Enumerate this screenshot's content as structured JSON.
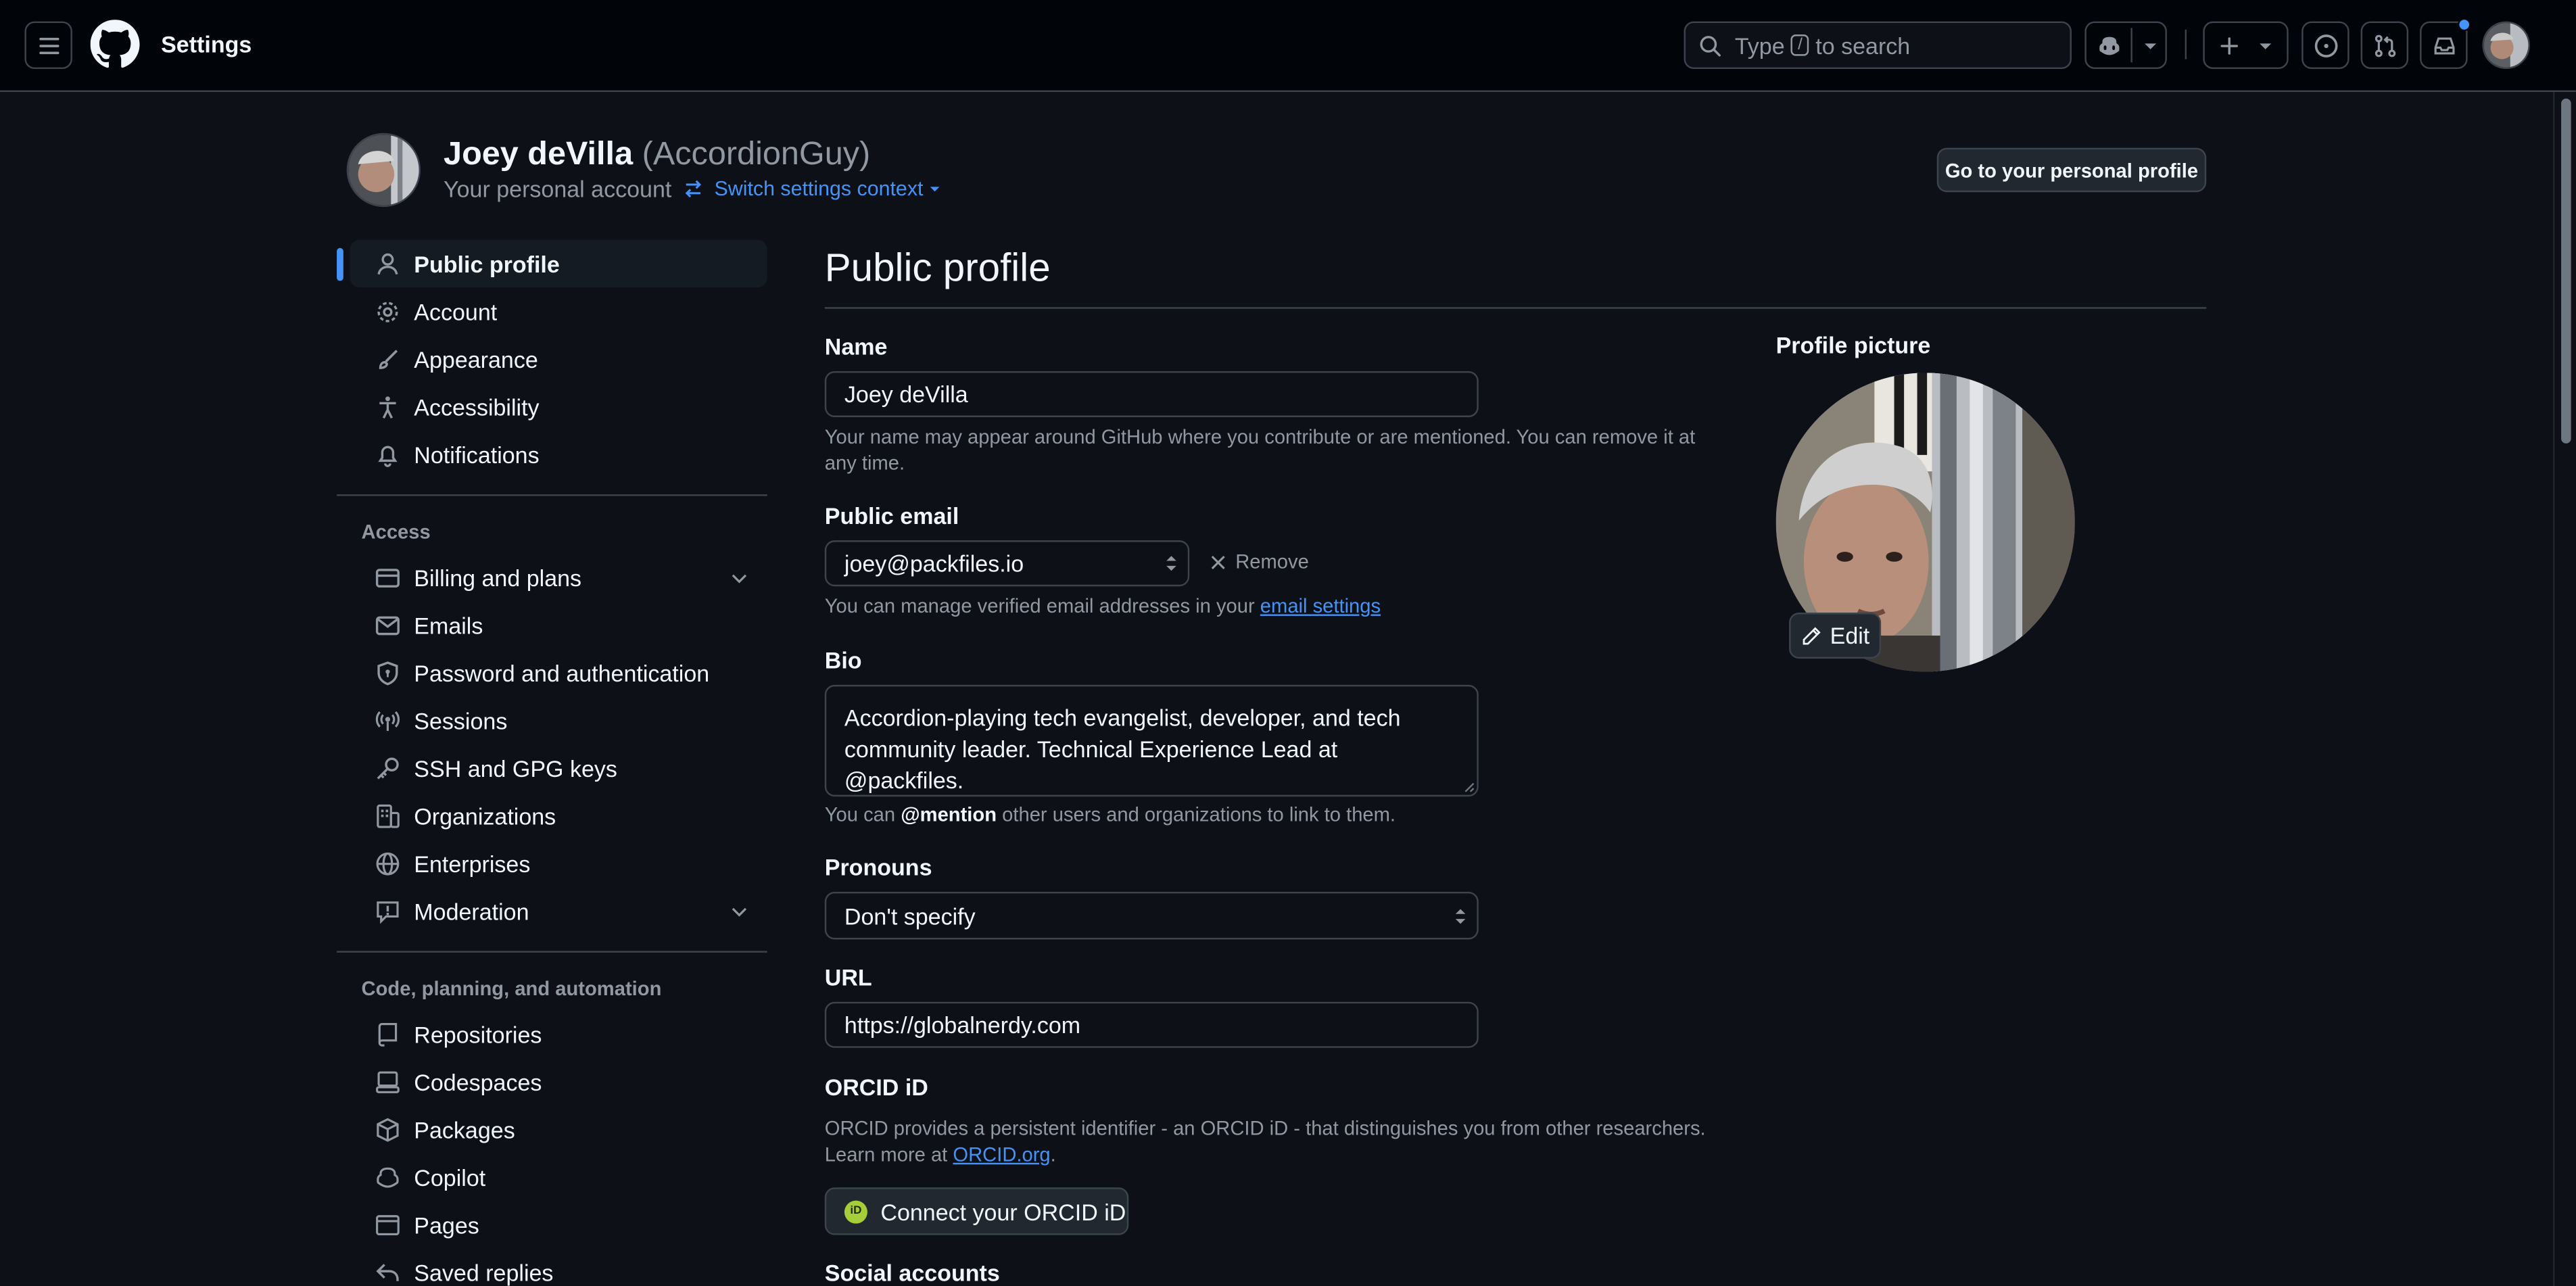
{
  "header": {
    "context_title": "Settings",
    "search": {
      "prefix": "Type",
      "key": "/",
      "suffix": "to search"
    }
  },
  "account": {
    "name": "Joey deVilla",
    "handle": "(AccordionGuy)",
    "subtitle": "Your personal account",
    "switch_label": "Switch settings context",
    "goto_profile": "Go to your personal profile"
  },
  "sidebar": {
    "top_items": [
      {
        "label": "Public profile",
        "icon": "person-icon",
        "active": true
      },
      {
        "label": "Account",
        "icon": "gear-icon"
      },
      {
        "label": "Appearance",
        "icon": "paintbrush-icon"
      },
      {
        "label": "Accessibility",
        "icon": "accessibility-icon"
      },
      {
        "label": "Notifications",
        "icon": "bell-icon"
      }
    ],
    "access_heading": "Access",
    "access_items": [
      {
        "label": "Billing and plans",
        "icon": "credit-card-icon",
        "expandable": true
      },
      {
        "label": "Emails",
        "icon": "mail-icon"
      },
      {
        "label": "Password and authentication",
        "icon": "shield-lock-icon"
      },
      {
        "label": "Sessions",
        "icon": "broadcast-icon"
      },
      {
        "label": "SSH and GPG keys",
        "icon": "key-icon"
      },
      {
        "label": "Organizations",
        "icon": "organization-icon"
      },
      {
        "label": "Enterprises",
        "icon": "globe-icon"
      },
      {
        "label": "Moderation",
        "icon": "report-icon",
        "expandable": true
      }
    ],
    "code_heading": "Code, planning, and automation",
    "code_items": [
      {
        "label": "Repositories",
        "icon": "repo-icon"
      },
      {
        "label": "Codespaces",
        "icon": "codespaces-icon"
      },
      {
        "label": "Packages",
        "icon": "package-icon"
      },
      {
        "label": "Copilot",
        "icon": "copilot-icon"
      },
      {
        "label": "Pages",
        "icon": "browser-icon"
      },
      {
        "label": "Saved replies",
        "icon": "reply-icon"
      }
    ]
  },
  "main": {
    "title": "Public profile",
    "name": {
      "label": "Name",
      "value": "Joey deVilla",
      "note": "Your name may appear around GitHub where you contribute or are mentioned. You can remove it at any time."
    },
    "email": {
      "label": "Public email",
      "value": "joey@packfiles.io",
      "remove_label": "Remove",
      "note_prefix": "You can manage verified email addresses in your",
      "note_link": "email settings"
    },
    "bio": {
      "label": "Bio",
      "value": "Accordion-playing tech evangelist, developer, and tech community leader. Technical Experience Lead at @packfiles.",
      "note_prefix": "You can",
      "note_mention": "@mention",
      "note_suffix": "other users and organizations to link to them."
    },
    "pronouns": {
      "label": "Pronouns",
      "value": "Don't specify"
    },
    "url": {
      "label": "URL",
      "value": "https://globalnerdy.com"
    },
    "orcid": {
      "label": "ORCID iD",
      "note_prefix": "ORCID provides a persistent identifier - an ORCID iD - that distinguishes you from other researchers. Learn more at",
      "note_link": "ORCID.org",
      "note_suffix": ".",
      "button": "Connect your ORCID iD",
      "badge": "iD"
    },
    "social": {
      "label": "Social accounts"
    },
    "profile_picture": {
      "label": "Profile picture",
      "edit_label": "Edit"
    }
  },
  "colors": {
    "background": "#0d1117",
    "header_bg": "#010409",
    "border": "#3d444d",
    "text": "#f0f6fc",
    "muted": "#9198a1",
    "accent": "#4493f8",
    "orcid_green": "#a6ce39"
  }
}
